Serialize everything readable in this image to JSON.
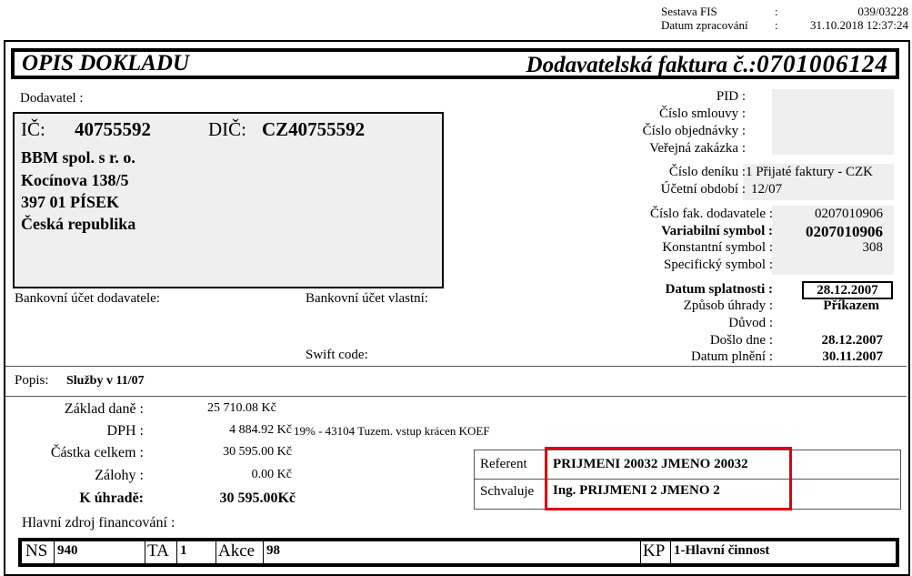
{
  "header": {
    "report_label": "Sestava FIS",
    "date_label": "Datum zpracování",
    "report_colon": ":",
    "date_colon": ":",
    "report_value": "039/03228",
    "date_value": "31.10.2018 12:37:24"
  },
  "title": {
    "left": "OPIS DOKLADU",
    "right_prefix": "Dodavatelská faktura č.:",
    "number": "0701006124"
  },
  "supplier": {
    "section_label": "Dodavatel :",
    "ic_label": "IČ:",
    "ic_value": "40755592",
    "dic_label": "DIČ:",
    "dic_value": "CZ40755592",
    "name": "BBM spol. s r. o.",
    "street": "Kocínova 138/5",
    "city": "397 01 PÍSEK",
    "country": "Česká republika"
  },
  "bank": {
    "supplier_account_label": "Bankovní účet dodavatele:",
    "own_account_label": "Bankovní účet vlastní:",
    "swift_label": "Swift code:"
  },
  "right_info": {
    "pid_label": "PID :",
    "contract_label": "Číslo smlouvy :",
    "order_label": "Číslo objednávky :",
    "public_label": "Veřejná zakázka :",
    "journal_label": "Číslo deníku :",
    "journal_value": "1 Přijaté faktury - CZK",
    "period_label": "Účetní období :",
    "period_value": "12/07",
    "supplier_invoice_label": "Číslo fak. dodavatele :",
    "supplier_invoice_value": "0207010906",
    "variable_label": "Variabilní symbol :",
    "variable_value": "0207010906",
    "constant_label": "Konstantní symbol :",
    "constant_value": "308",
    "specific_label": "Specifický symbol :",
    "due_label": "Datum splatnosti :",
    "due_value": "28.12.2007",
    "payment_label": "Způsob úhrady :",
    "payment_value": "Příkazem",
    "reason_label": "Důvod :",
    "received_label": "Došlo dne :",
    "received_value": "28.12.2007",
    "fulfilment_label": "Datum plnění :",
    "fulfilment_value": "30.11.2007"
  },
  "description": {
    "label": "Popis:",
    "value": "Služby v 11/07"
  },
  "amounts": {
    "base_label": "Základ daně :",
    "base_value": "25 710.08 Kč",
    "vat_label": "DPH :",
    "vat_value": "4 884.92 Kč",
    "vat_note": "19% - 43104 Tuzem. vstup krácen KOEF",
    "total_label": "Částka celkem :",
    "total_value": "30 595.00 Kč",
    "advances_label": "Zálohy :",
    "advances_value": "0.00 Kč",
    "topay_label": "K úhradě:",
    "topay_value": "30 595.00Kč"
  },
  "approval": {
    "referent_label": "Referent",
    "referent_value": "PRIJMENI 20032 JMENO 20032",
    "approver_label": "Schvaluje",
    "approver_value": "Ing. PRIJMENI 2 JMENO 2"
  },
  "funding": {
    "label": "Hlavní zdroj financování :",
    "ns_label": "NS",
    "ns_value": "940",
    "ta_label": "TA",
    "ta_value": "1",
    "akce_label": "Akce",
    "akce_value": "98",
    "kp_label": "KP",
    "kp_value": "1-Hlavní činnost"
  },
  "colors": {
    "highlight_border": "#e00010",
    "field_background": "#efefef"
  }
}
